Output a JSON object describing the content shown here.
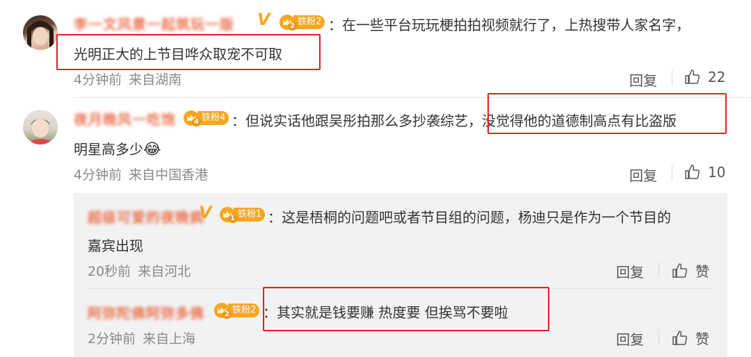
{
  "comments": [
    {
      "fan_label": "铁粉2",
      "fan_level": "2",
      "text_line1": "：在一些平台玩玩梗拍拍视频就行了，上热搜带人家名字，",
      "text_line2": "光明正大的上节目哗众取宠不可取",
      "time": "4分钟前",
      "source": "来自湖南",
      "reply_label": "回复",
      "likes": "22"
    },
    {
      "fan_label": "铁粉4",
      "fan_level": "4",
      "text_line1": "：但说实话他跟吴彤拍那么多抄袭综艺，没觉得他的道德制高点有比盗版",
      "text_line2": "明星高多少",
      "emoji": "😂",
      "time": "4分钟前",
      "source": "来自中国香港",
      "reply_label": "回复",
      "likes": "10"
    }
  ],
  "replies": [
    {
      "fan_label": "铁粉1",
      "fan_level": "1",
      "text_line1": "：这是梧桐的问题吧或者节目组的问题，杨迪只是作为一个节目的",
      "text_line2": "嘉宾出现",
      "time": "20秒前",
      "source": "来自河北",
      "reply_label": "回复",
      "likes": "赞"
    },
    {
      "fan_label": "铁粉2",
      "fan_level": "2",
      "text_line1": "：其实就是钱要赚 热度要 但挨骂不要啦",
      "time": "2分钟前",
      "source": "来自上海",
      "reply_label": "回复",
      "likes": "赞"
    }
  ],
  "colors": {
    "username": "#eb7350",
    "highlight_box": "#e02020",
    "fan_badge": "#f5a623"
  },
  "icons": {
    "like": "thumbs-up-icon",
    "verified": "verified-v-icon",
    "fan_badge": "crown-icon"
  }
}
